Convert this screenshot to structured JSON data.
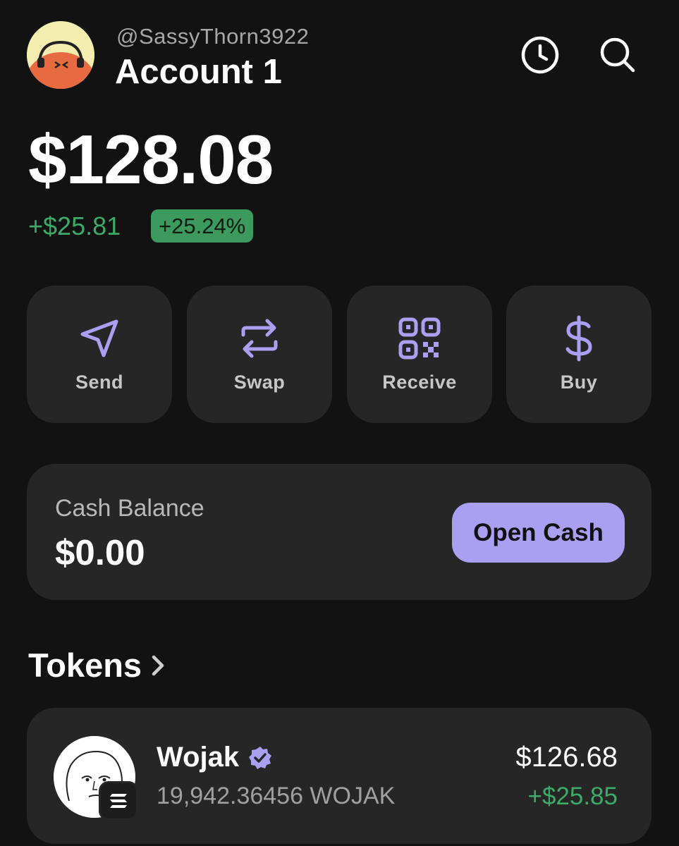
{
  "header": {
    "username": "@SassyThorn3922",
    "account_name": "Account 1",
    "icons": [
      "clock-icon",
      "search-icon"
    ]
  },
  "portfolio": {
    "balance": "$128.08",
    "change_amount": "+$25.81",
    "change_percent": "+25.24%"
  },
  "actions": [
    {
      "label": "Send",
      "icon": "send-icon"
    },
    {
      "label": "Swap",
      "icon": "swap-icon"
    },
    {
      "label": "Receive",
      "icon": "qr-code-icon"
    },
    {
      "label": "Buy",
      "icon": "dollar-icon"
    }
  ],
  "cash": {
    "title": "Cash Balance",
    "value": "$0.00",
    "button_label": "Open Cash"
  },
  "tokens": {
    "heading": "Tokens",
    "items": [
      {
        "name": "Wojak",
        "amount": "19,942.36456 WOJAK",
        "usd_value": "$126.68",
        "change": "+$25.85"
      }
    ]
  },
  "colors": {
    "background": "#121212",
    "card": "#262626",
    "accent": "#ab9ff2",
    "positive": "#3dab67"
  }
}
